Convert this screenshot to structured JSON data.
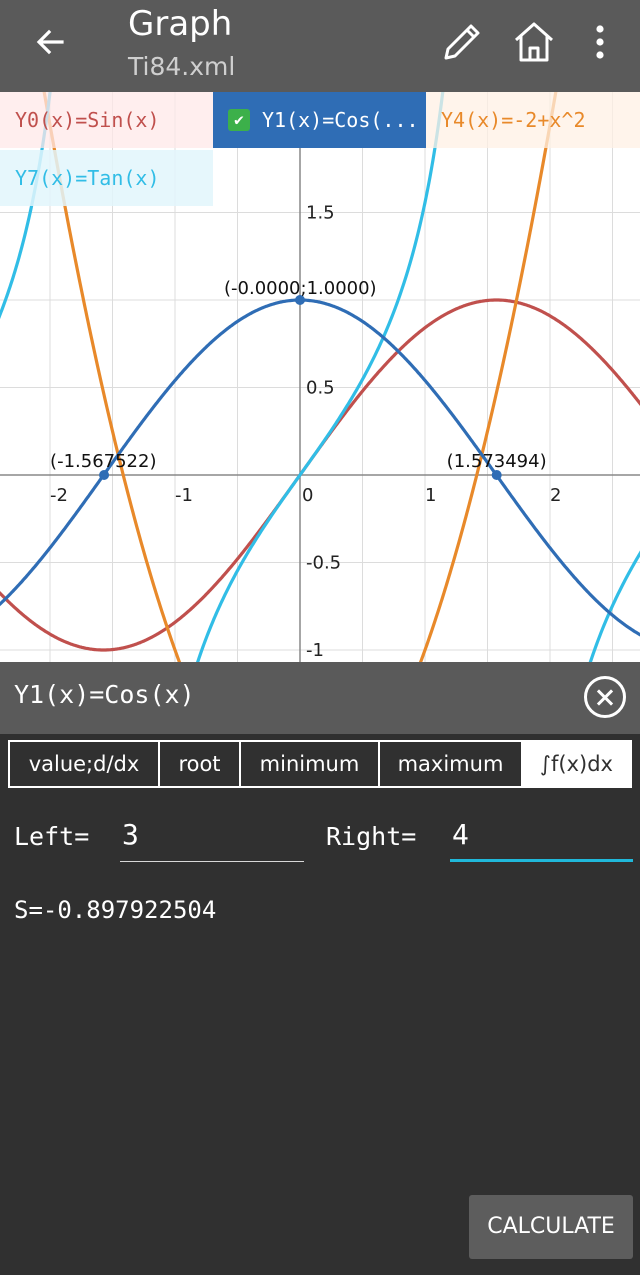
{
  "appbar": {
    "title": "Graph",
    "subtitle": "Ti84.xml",
    "icons": [
      "back-arrow-icon",
      "pencil-icon",
      "home-icon",
      "more-vert-icon"
    ]
  },
  "functions": [
    {
      "label": "Y0(x)=Sin(x)",
      "color": "#c0504d",
      "selected": false
    },
    {
      "label": "Y1(x)=Cos(...",
      "color": "#2f6db5",
      "selected": true
    },
    {
      "label": "Y4(x)=-2+x^2",
      "color": "#e8892a",
      "selected": false
    },
    {
      "label": "Y7(x)=Tan(x)",
      "color": "#31bde6",
      "selected": false
    }
  ],
  "graph": {
    "x_ticks": [
      "-2",
      "-1",
      "0",
      "1",
      "2"
    ],
    "y_ticks": [
      "1.5",
      "0.5",
      "-0.5",
      "-1"
    ],
    "x_range": [
      -2.4,
      2.7
    ],
    "y_range": [
      -1.05,
      1.6
    ],
    "point_labels": {
      "max": "(-0.0000;1.0000)",
      "root_left": "(-1.567522)",
      "root_right": "(1.573494)"
    }
  },
  "panel": {
    "title": "Y1(x)=Cos(x)",
    "tabs": [
      "value;d/dx",
      "root",
      "minimum",
      "maximum",
      "∫f(x)dx"
    ],
    "selected_tab": "∫f(x)dx",
    "left_label": "Left=",
    "left_value": "3",
    "right_label": "Right=",
    "right_value": "4",
    "result": "S=-0.897922504",
    "calculate_label": "CALCULATE"
  }
}
